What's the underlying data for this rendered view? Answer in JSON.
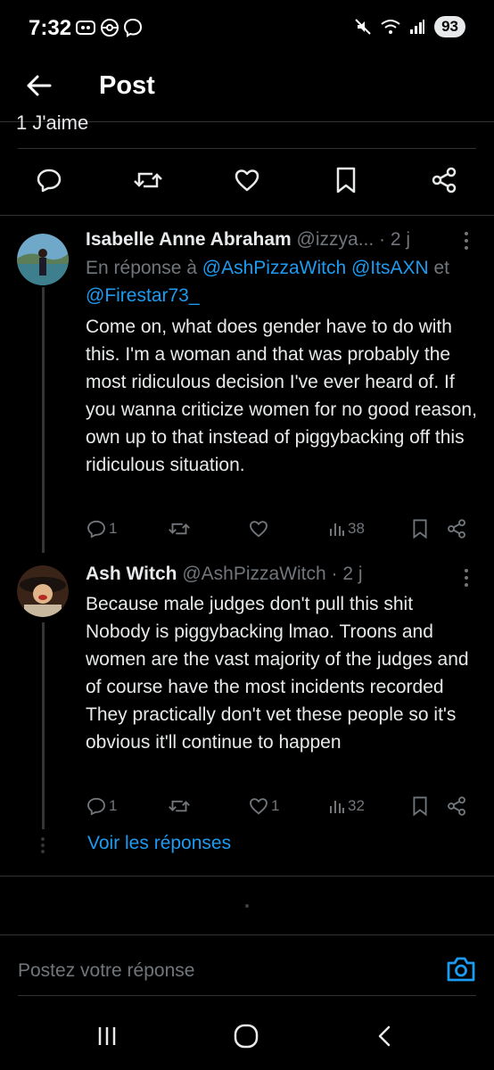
{
  "status_bar": {
    "time": "7:32",
    "battery": "93",
    "icons_left": [
      "gamepad-icon",
      "pokeball-icon",
      "messenger-icon"
    ],
    "icons_right": [
      "mute-icon",
      "wifi-icon",
      "signal-icon"
    ]
  },
  "header": {
    "title": "Post",
    "back_icon": "arrow-left-icon"
  },
  "previous_post": {
    "likes_text": "1 J'aime"
  },
  "action_bar": {
    "icons": [
      "reply-icon",
      "retweet-icon",
      "like-icon",
      "bookmark-icon",
      "share-icon"
    ]
  },
  "replies": [
    {
      "name": "Isabelle Anne Abraham",
      "handle": "@izzya...",
      "separator": "·",
      "time": "2 j",
      "reply_prefix": "En réponse à",
      "mention_1": "@AshPizzaWitch",
      "mention_2": "@ItsAXN",
      "reply_and": "et",
      "mention_3": "@Firestar73_",
      "text": "Come on, what does gender have to do with this. I'm a woman and that was probably the most ridiculous decision I've ever heard of. If you wanna criticize women for no good reason, own up to that instead of piggybacking off this ridiculous situation.",
      "reply_count": "1",
      "like_count": "",
      "view_count": "38"
    },
    {
      "name": "Ash Witch",
      "handle": "@AshPizzaWitch",
      "separator": "·",
      "time": "2 j",
      "text_line_1": "Because male judges don't pull this shit",
      "text_line_2": "Nobody is piggybacking lmao. Troons and women are the vast majority of the judges and of course have the most incidents recorded",
      "text_line_3": "They practically don't vet these people so it's obvious it'll continue to happen",
      "reply_count": "1",
      "like_count": "1",
      "view_count": "32"
    }
  ],
  "show_replies_label": "Voir les réponses",
  "compose": {
    "placeholder": "Postez votre réponse"
  },
  "colors": {
    "accent": "#1d9bf0",
    "muted": "#71767b",
    "text": "#e7e9ea",
    "background": "#000000",
    "divider": "#2f3336"
  }
}
